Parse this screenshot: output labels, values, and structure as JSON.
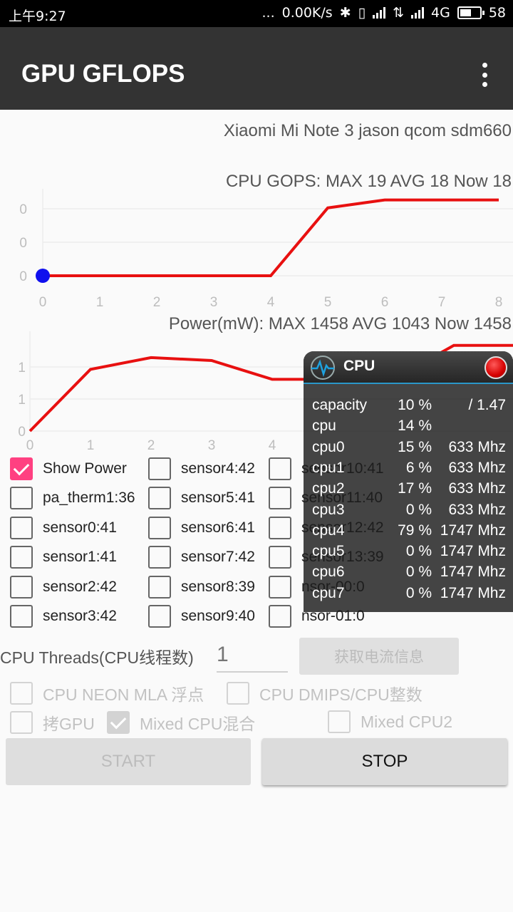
{
  "status_bar": {
    "time": "上午9:27",
    "more": "...",
    "net_speed": "0.00K/s",
    "network": "4G",
    "battery": "58",
    "battery_level": 0.58
  },
  "app_bar": {
    "title": "GPU GFLOPS"
  },
  "device": "Xiaomi Mi Note 3 jason qcom sdm660",
  "charts": [
    {
      "chart_data": {
        "type": "line",
        "title": "CPU GOPS: MAX 19 AVG 18 Now 18",
        "x": [
          0,
          1,
          2,
          3,
          4,
          5,
          6,
          7,
          8
        ],
        "y_tick_labels": [
          "0",
          "0",
          "0"
        ],
        "series": [
          {
            "values": [
              0,
              0,
              0,
              0,
              0,
              17,
              19,
              19,
              19
            ],
            "color": "#e81010"
          }
        ],
        "marker": {
          "x": 0,
          "y": 0,
          "color": "#1010ee"
        },
        "ylim": [
          0,
          20
        ],
        "grid": true
      }
    },
    {
      "chart_data": {
        "type": "line",
        "title": "Power(mW): MAX 1458 AVG 1043 Now 1458",
        "x": [
          0,
          1,
          2,
          3,
          4
        ],
        "x_tick_labels": [
          "0",
          "1",
          "2",
          "3",
          "4"
        ],
        "y_tick_labels": [
          "1",
          "1",
          "0"
        ],
        "series": [
          {
            "values": [
              0,
              1050,
              1250,
              1200,
              880,
              880,
              880,
              1458,
              1458
            ],
            "x": [
              0,
              1,
              2,
              3,
              4,
              5,
              6,
              7,
              8
            ],
            "color": "#e81010"
          }
        ],
        "ylim": [
          0,
          1600
        ],
        "grid": true
      }
    }
  ],
  "sensors": {
    "col1": [
      {
        "label": "Show Power",
        "checked": true
      },
      {
        "label": "pa_therm1:36",
        "checked": false
      },
      {
        "label": "sensor0:41",
        "checked": false
      },
      {
        "label": "sensor1:41",
        "checked": false
      },
      {
        "label": "sensor2:42",
        "checked": false
      },
      {
        "label": "sensor3:42",
        "checked": false
      }
    ],
    "col2": [
      {
        "label": "sensor4:42",
        "checked": false
      },
      {
        "label": "sensor5:41",
        "checked": false
      },
      {
        "label": "sensor6:41",
        "checked": false
      },
      {
        "label": "sensor7:42",
        "checked": false
      },
      {
        "label": "sensor8:39",
        "checked": false
      },
      {
        "label": "sensor9:40",
        "checked": false
      }
    ],
    "col3": [
      {
        "label": "sensor10:41",
        "checked": false
      },
      {
        "label": "sensor11:40",
        "checked": false
      },
      {
        "label": "sensor12:42",
        "checked": false
      },
      {
        "label": "sensor13:39",
        "checked": false
      },
      {
        "label": "nsor-00:0",
        "checked": false
      },
      {
        "label": "nsor-01:0",
        "checked": false
      }
    ]
  },
  "threads": {
    "label": "CPU Threads(CPU线程数)",
    "placeholder": "1",
    "power_button": "获取电流信息"
  },
  "options": [
    {
      "label": "CPU NEON MLA 浮点",
      "checked": false
    },
    {
      "label": "CPU DMIPS/CPU整数",
      "checked": false
    },
    {
      "label": "拷GPU",
      "checked": false
    },
    {
      "label": "Mixed CPU混合",
      "checked": true
    },
    {
      "label": "Mixed CPU2",
      "checked": false
    }
  ],
  "buttons": {
    "start": "START",
    "stop": "STOP"
  },
  "cpu_panel": {
    "title": "CPU",
    "rows": [
      {
        "name": "capacity",
        "percent": "10 %",
        "freq": "/ 1.47"
      },
      {
        "name": "cpu",
        "percent": "14 %",
        "freq": ""
      },
      {
        "name": "cpu0",
        "percent": "15 %",
        "freq": "633 Mhz"
      },
      {
        "name": "cpu1",
        "percent": "6 %",
        "freq": "633 Mhz"
      },
      {
        "name": "cpu2",
        "percent": "17 %",
        "freq": "633 Mhz"
      },
      {
        "name": "cpu3",
        "percent": "0 %",
        "freq": "633 Mhz"
      },
      {
        "name": "cpu4",
        "percent": "79 %",
        "freq": "1747 Mhz"
      },
      {
        "name": "cpu5",
        "percent": "0 %",
        "freq": "1747 Mhz"
      },
      {
        "name": "cpu6",
        "percent": "0 %",
        "freq": "1747 Mhz"
      },
      {
        "name": "cpu7",
        "percent": "0 %",
        "freq": "1747 Mhz"
      }
    ]
  }
}
